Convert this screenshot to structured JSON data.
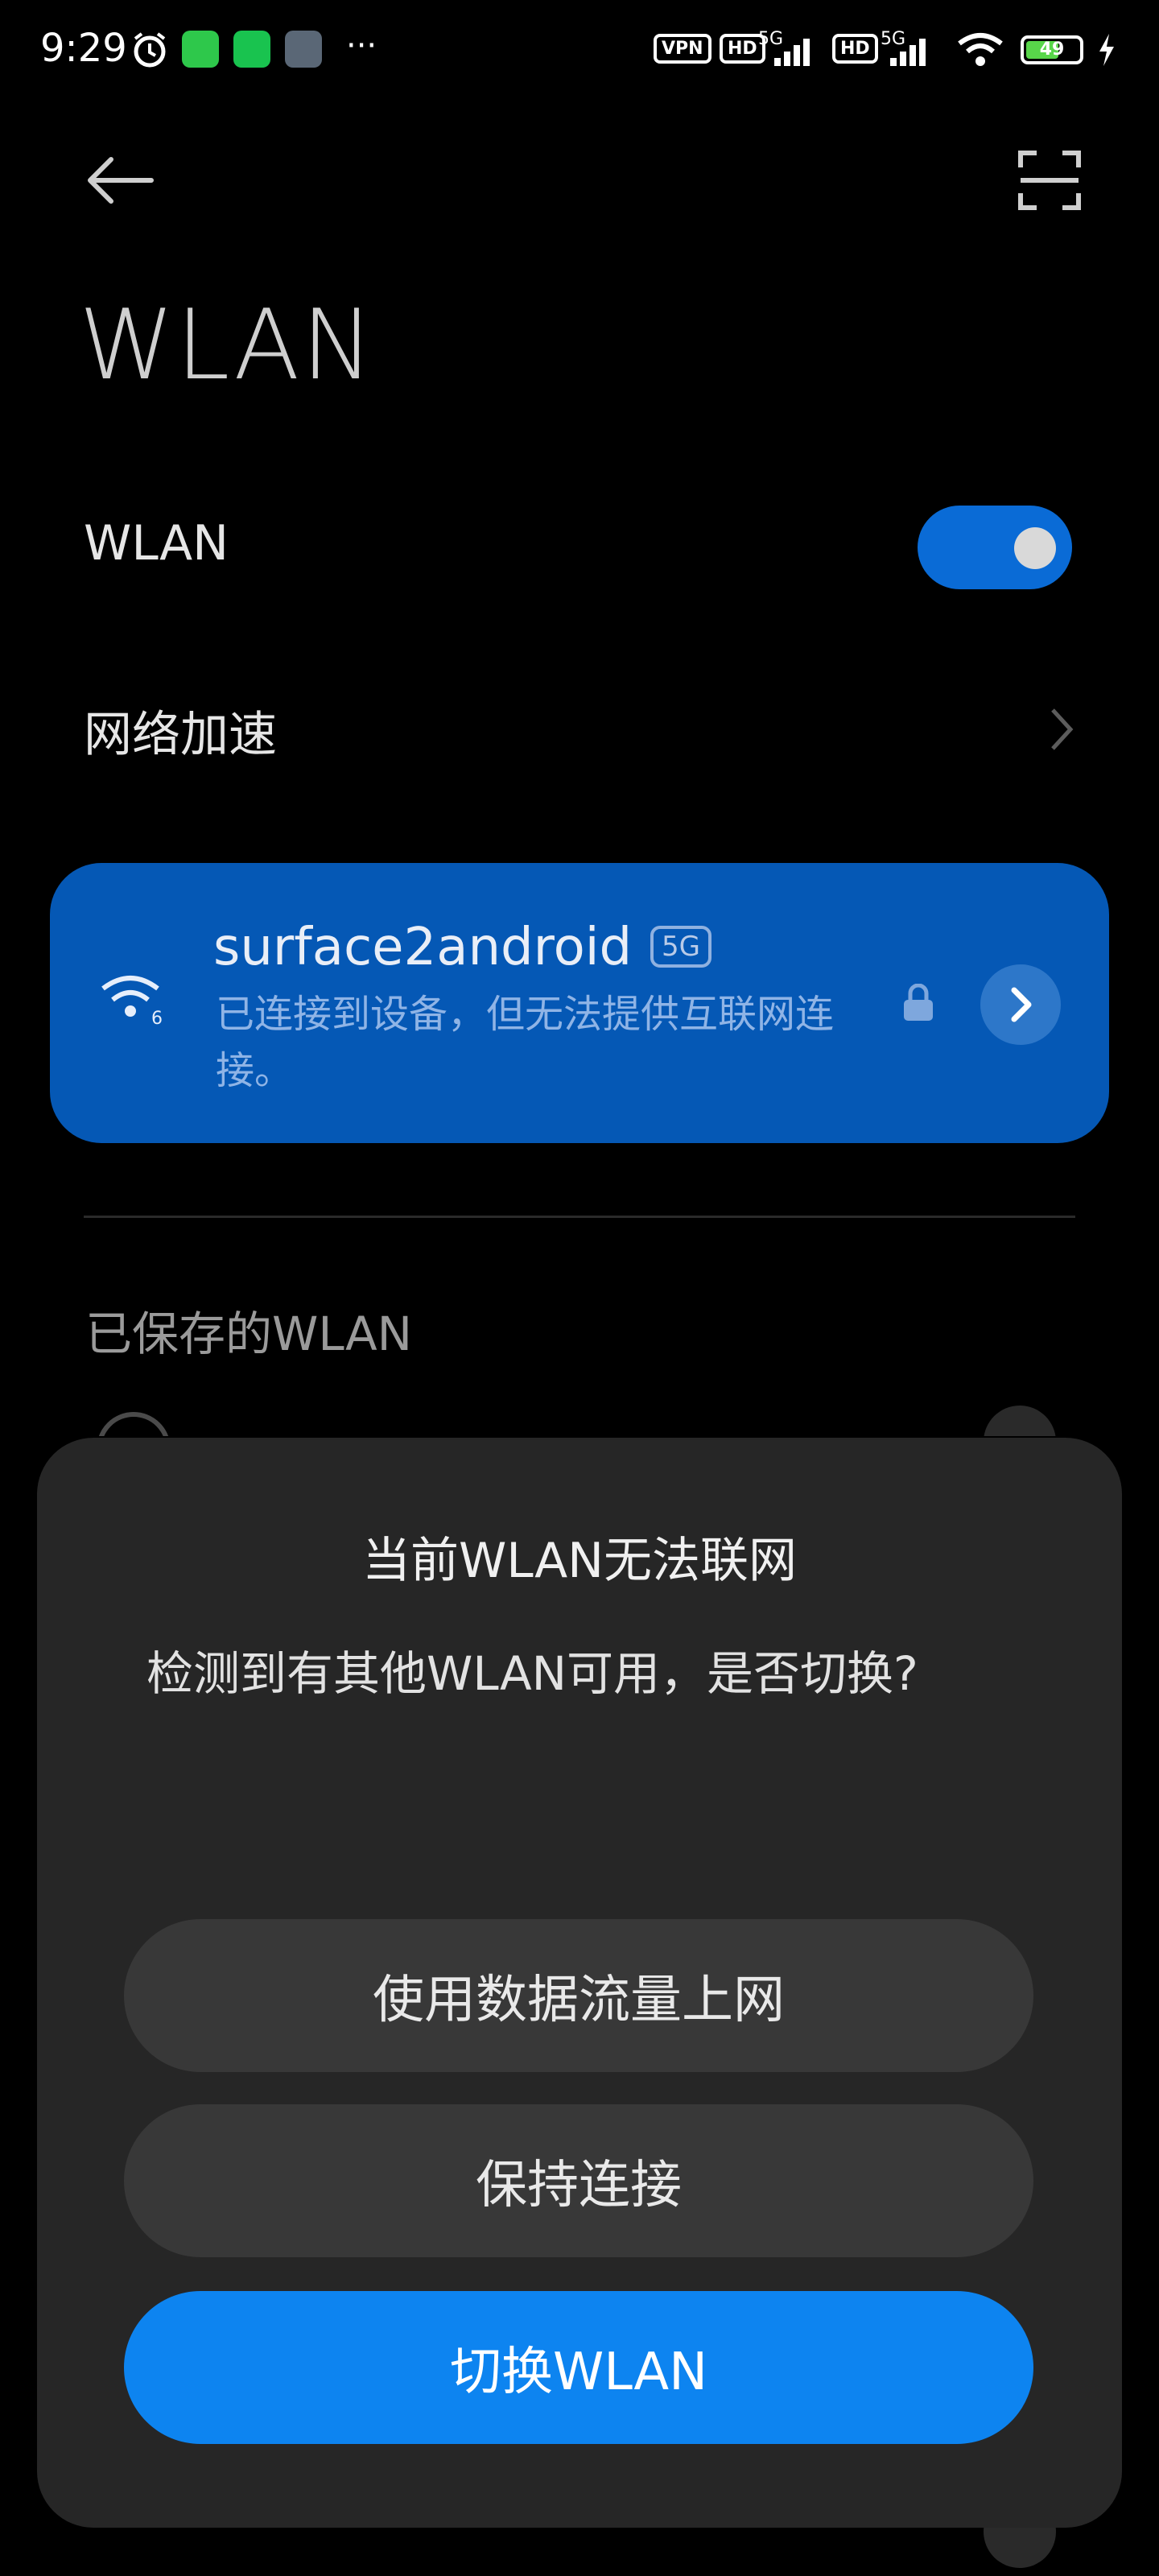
{
  "status_bar": {
    "time": "9:29",
    "battery": "49",
    "badges": [
      "VPN",
      "HD",
      "5G",
      "HD",
      "5G"
    ],
    "more": "···"
  },
  "header": {
    "page_title": "WLAN"
  },
  "wlan_row": {
    "label": "WLAN",
    "enabled": true
  },
  "accel_row": {
    "label": "网络加速"
  },
  "connected": {
    "ssid": "surface2android",
    "band": "5G",
    "wifi_gen": "6",
    "status": "已连接到设备，但无法提供互联网连接。"
  },
  "saved_section": {
    "label": "已保存的WLAN"
  },
  "dialog": {
    "title": "当前WLAN无法联网",
    "message": "检测到有其他WLAN可用，是否切换?",
    "buttons": {
      "use_data": "使用数据流量上网",
      "keep": "保持连接",
      "switch": "切换WLAN"
    }
  },
  "colors": {
    "accent": "#0d84f0",
    "card": "#0558b5",
    "dialog_bg": "#262626"
  }
}
